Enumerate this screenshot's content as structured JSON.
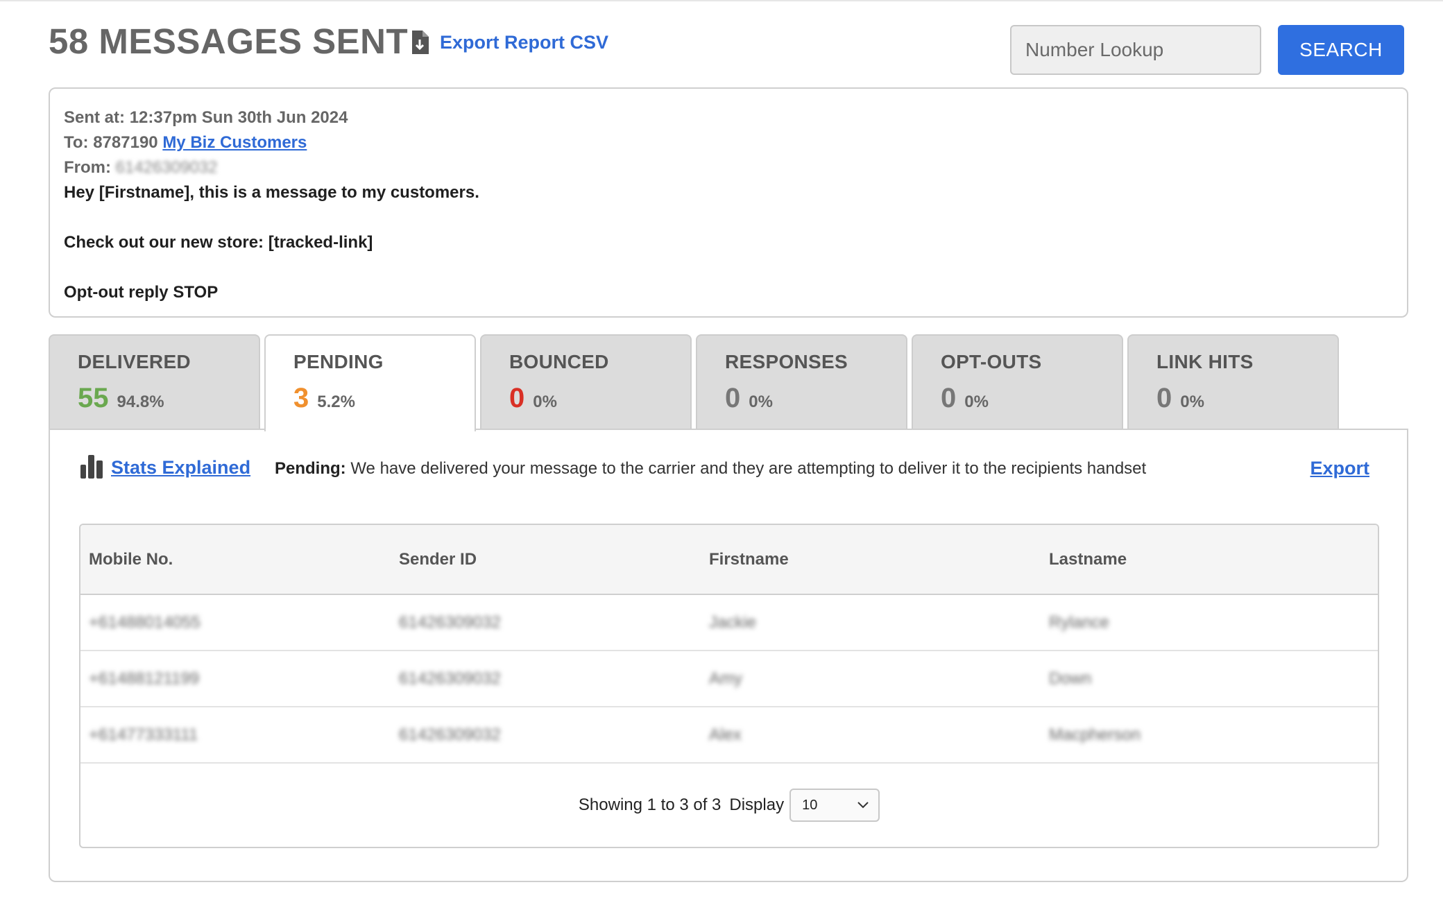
{
  "header": {
    "title": "58 MESSAGES SENT",
    "export_csv_label": "Export Report CSV",
    "lookup_placeholder": "Number Lookup",
    "search_label": "SEARCH"
  },
  "message": {
    "sent_at_label": "Sent at:",
    "sent_at_value": "12:37pm Sun 30th Jun 2024",
    "to_label": "To:",
    "to_number": "8787190",
    "to_list_name": "My Biz Customers",
    "from_label": "From:",
    "from_value": "61426309032",
    "body": "Hey [Firstname], this is a message to my customers.\n\nCheck out our new store: [tracked-link]\n\nOpt-out reply STOP"
  },
  "tabs": [
    {
      "title": "DELIVERED",
      "count": "55",
      "pct": "94.8%",
      "color": "#6aa84f"
    },
    {
      "title": "PENDING",
      "count": "3",
      "pct": "5.2%",
      "color": "#f0902e"
    },
    {
      "title": "BOUNCED",
      "count": "0",
      "pct": "0%",
      "color": "#d93025"
    },
    {
      "title": "RESPONSES",
      "count": "0",
      "pct": "0%",
      "color": "#777777"
    },
    {
      "title": "OPT-OUTS",
      "count": "0",
      "pct": "0%",
      "color": "#777777"
    },
    {
      "title": "LINK HITS",
      "count": "0",
      "pct": "0%",
      "color": "#777777"
    }
  ],
  "active_tab": "PENDING",
  "panel": {
    "stats_explained_label": "Stats Explained",
    "description_label": "Pending:",
    "description_text": "We have delivered your message to the carrier and they are attempting to deliver it to the recipients handset",
    "export_label": "Export"
  },
  "table": {
    "columns": [
      "Mobile No.",
      "Sender ID",
      "Firstname",
      "Lastname"
    ],
    "rows": [
      [
        "+61488014055",
        "61426309032",
        "Jackie",
        "Rylance"
      ],
      [
        "+61488121199",
        "61426309032",
        "Amy",
        "Down"
      ],
      [
        "+61477333111",
        "61426309032",
        "Alex",
        "Macpherson"
      ]
    ]
  },
  "pagination": {
    "info": "Showing 1 to 3 of 3",
    "display_label": "Display",
    "page_size": "10"
  }
}
